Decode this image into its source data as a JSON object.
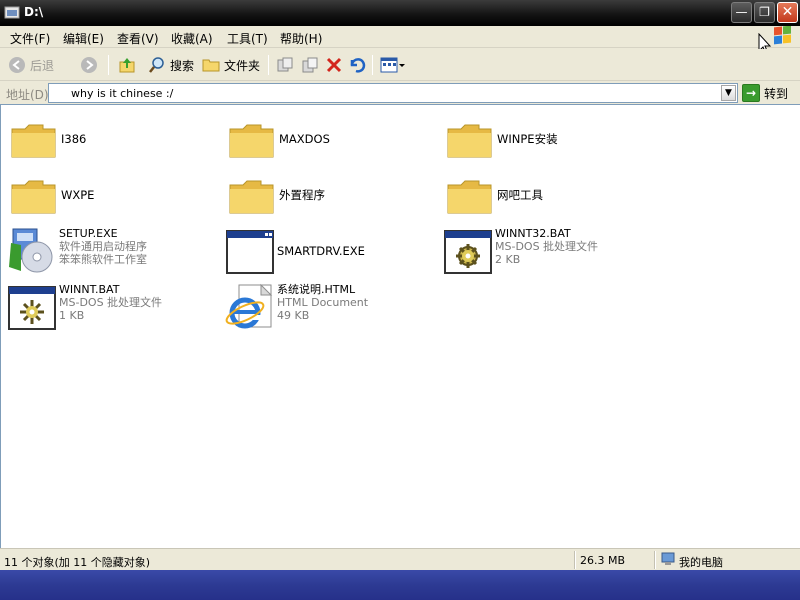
{
  "window": {
    "title": "D:\\"
  },
  "caption_buttons": {
    "minimize": "—",
    "maximize": "❐",
    "close": "✕"
  },
  "menu": [
    "文件(F)",
    "编辑(E)",
    "查看(V)",
    "收藏(A)",
    "工具(T)",
    "帮助(H)"
  ],
  "toolbar": {
    "back": "后退",
    "search": "搜索",
    "folders": "文件夹"
  },
  "address": {
    "label": "地址(D)",
    "value": "why is it chinese :/",
    "go": "转到"
  },
  "items": [
    {
      "name": "I386",
      "type": "folder"
    },
    {
      "name": "MAXDOS",
      "type": "folder"
    },
    {
      "name": "WINPE安装",
      "type": "folder"
    },
    {
      "name": "WXPE",
      "type": "folder"
    },
    {
      "name": "外置程序",
      "type": "folder"
    },
    {
      "name": "网吧工具",
      "type": "folder"
    },
    {
      "name": "SETUP.EXE",
      "line2": "软件通用启动程序",
      "line3": "笨笨熊软件工作室",
      "type": "setup"
    },
    {
      "name": "SMARTDRV.EXE",
      "type": "exe"
    },
    {
      "name": "WINNT32.BAT",
      "line2": "MS-DOS 批处理文件",
      "line3": "2 KB",
      "type": "bat"
    },
    {
      "name": "WINNT.BAT",
      "line2": "MS-DOS 批处理文件",
      "line3": "1 KB",
      "type": "bat"
    },
    {
      "name": "系统说明.HTML",
      "line2": "HTML Document",
      "line3": "49 KB",
      "type": "html"
    }
  ],
  "status": {
    "objects": "11 个对象(加 11 个隐藏对象)",
    "size": "26.3 MB",
    "location": "我的电脑"
  },
  "colors": {
    "folder": "#f5d66b",
    "taskbar": "#2d3a93",
    "close": "#c3391c"
  }
}
